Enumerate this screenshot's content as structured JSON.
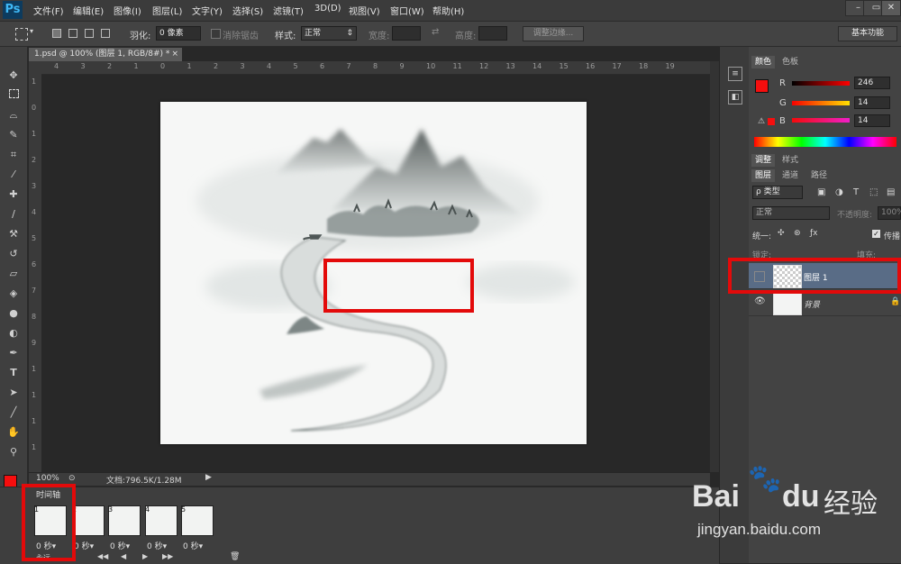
{
  "app": {
    "logo": "Ps"
  },
  "menu": [
    "文件(F)",
    "编辑(E)",
    "图像(I)",
    "图层(L)",
    "文字(Y)",
    "选择(S)",
    "滤镜(T)",
    "3D(D)",
    "视图(V)",
    "窗口(W)",
    "帮助(H)"
  ],
  "window_controls": [
    "–",
    "▭",
    "✕"
  ],
  "options": {
    "feather_label": "羽化:",
    "feather_value": "0 像素",
    "antialias_label": "消除锯齿",
    "style_label": "样式:",
    "style_value": "正常",
    "width_label": "宽度:",
    "height_label": "高度:",
    "refine_edge": "调整边缘...",
    "workspace": "基本功能"
  },
  "document": {
    "tab_title": "1.psd @ 100% (图层 1, RGB/8#) *",
    "ruler_top": [
      "4",
      "3",
      "2",
      "1",
      "0",
      "1",
      "2",
      "3",
      "4",
      "5",
      "6",
      "7",
      "8",
      "9",
      "10",
      "11",
      "12",
      "13",
      "14",
      "15",
      "16",
      "17",
      "18",
      "19"
    ],
    "ruler_left": [
      "1",
      "0",
      "1",
      "2",
      "3",
      "4",
      "5",
      "6",
      "7",
      "8",
      "9",
      "1",
      "1",
      "1",
      "1"
    ],
    "zoom": "100%",
    "doc_info": "文档:796.5K/1.28M"
  },
  "timeline": {
    "title": "时间轴",
    "frames": [
      {
        "num": "1",
        "time": "0 秒▾"
      },
      {
        "num": "2",
        "time": "0 秒▾"
      },
      {
        "num": "3",
        "time": "0 秒▾"
      },
      {
        "num": "4",
        "time": "0 秒▾"
      },
      {
        "num": "5",
        "time": "0 秒▾"
      }
    ],
    "loop": "永远",
    "controls": [
      "◀◀",
      "◀",
      "▶",
      "▶▶"
    ]
  },
  "color_panel": {
    "tabs": [
      "颜色",
      "色板"
    ],
    "r_label": "R",
    "r_value": "246",
    "g_label": "G",
    "g_value": "14",
    "b_label": "B",
    "b_value": "14",
    "foreground": "#f60e0e"
  },
  "adjust_panel": {
    "tabs": [
      "调整",
      "样式"
    ]
  },
  "layers_panel": {
    "tabs": [
      "图层",
      "通道",
      "路径"
    ],
    "filter_label": "ρ 类型",
    "blend_mode": "正常",
    "opacity_label": "不透明度:",
    "opacity_value": "100%",
    "unify_label": "统一:",
    "propagate_label": "传播",
    "lock_label": "锁定:",
    "fill_label": "填充:",
    "layers": [
      {
        "name": "图层 1",
        "selected": true
      },
      {
        "name": "背景",
        "selected": false
      }
    ]
  },
  "watermark": {
    "brand": "Bai",
    "brand2": "du",
    "cn": "经验",
    "url": "jingyan.baidu.com"
  },
  "colors": {
    "accent_red": "#e30a0a",
    "selected_layer": "#596c86"
  }
}
